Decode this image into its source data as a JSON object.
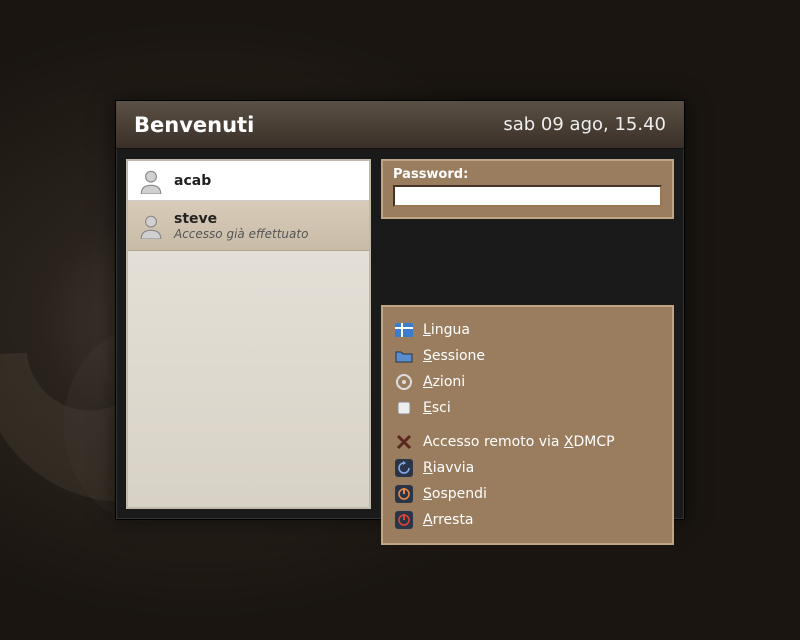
{
  "header": {
    "welcome": "Benvenuti",
    "datetime": "sab 09 ago, 15.40"
  },
  "users": [
    {
      "name": "acab",
      "status": "",
      "selected": false
    },
    {
      "name": "steve",
      "status": "Accesso già effettuato",
      "selected": true
    }
  ],
  "password": {
    "label": "Password:",
    "value": ""
  },
  "actions": {
    "language": "Lingua",
    "session": "Sessione",
    "actions": "Azioni",
    "quit": "Esci",
    "remote_pre": "Accesso remoto via ",
    "remote_post": "DMCP",
    "restart": "iavvia",
    "suspend": "ospendi",
    "shutdown": "rresta"
  }
}
